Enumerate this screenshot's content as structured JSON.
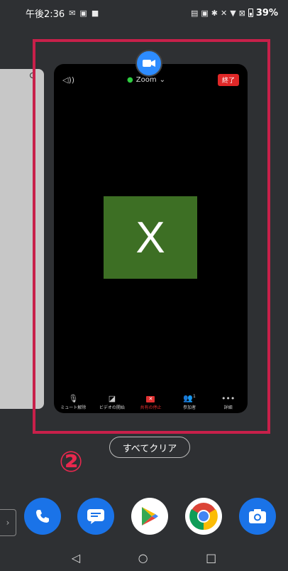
{
  "status_bar": {
    "time": "午後2:36",
    "battery": "39%",
    "icons": [
      "gmail-icon",
      "gallery-icon",
      "video-icon",
      "cast-icon",
      "notification-icon",
      "bluetooth-icon",
      "mute-icon",
      "wifi-icon",
      "no-sim-icon",
      "battery-icon"
    ]
  },
  "recent_app": {
    "title": "Zoom",
    "end_label": "終了",
    "participant_initial": "X",
    "tile_color": "#3d6f24",
    "toolbar": [
      {
        "label": "ミュート解除",
        "icon": "mic-off-icon"
      },
      {
        "label": "ビデオの開始",
        "icon": "video-off-icon"
      },
      {
        "label": "共有の停止",
        "icon": "stop-share-icon"
      },
      {
        "label": "参加者",
        "icon": "participants-icon",
        "count": "1"
      },
      {
        "label": "詳細",
        "icon": "more-icon"
      }
    ]
  },
  "clear_all_label": "すべてクリア",
  "step_marker": "②",
  "highlight_color": "#c8204a",
  "dock": [
    {
      "name": "phone",
      "icon": "phone-icon",
      "color": "#1a73e8"
    },
    {
      "name": "messages",
      "icon": "messages-icon",
      "color": "#1a73e8"
    },
    {
      "name": "play-store",
      "icon": "play-store-icon",
      "color": "#ffffff"
    },
    {
      "name": "chrome",
      "icon": "chrome-icon",
      "color": "#ffffff"
    },
    {
      "name": "camera",
      "icon": "camera-icon",
      "color": "#1a73e8"
    }
  ],
  "nav": [
    "back-icon",
    "home-icon",
    "recents-icon"
  ]
}
